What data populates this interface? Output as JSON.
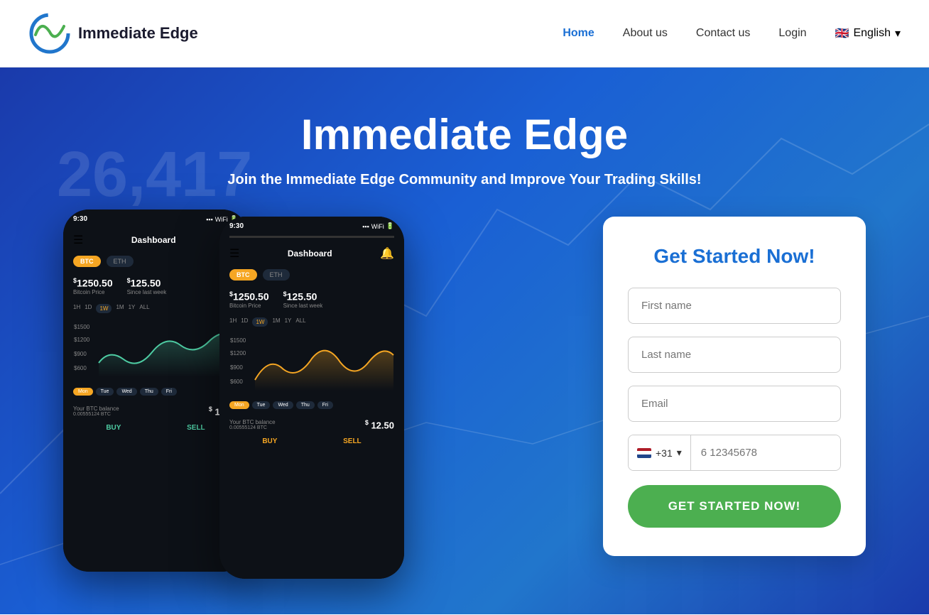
{
  "header": {
    "logo_text": "Immediate Edge",
    "nav": {
      "home": "Home",
      "about": "About us",
      "contact": "Contact us",
      "login": "Login",
      "lang": "English"
    }
  },
  "hero": {
    "bg_number": "26,417",
    "title": "Immediate Edge",
    "subtitle": "Join the Immediate Edge Community and Improve Your Trading Skills!",
    "phone1": {
      "time": "9:30",
      "title": "Dashboard",
      "btc": "BTC",
      "eth": "ETH",
      "price1_label": "Bitcoin Price",
      "price1_amount": "$1250.50",
      "price2_label": "Since last week",
      "price2_amount": "$125.50",
      "time_tabs": [
        "1H",
        "1D",
        "1W",
        "1M",
        "1Y",
        "ALL"
      ],
      "active_tab": "1W",
      "chart_label": "green",
      "days": [
        "Mon",
        "Tue",
        "Wed",
        "Thu",
        "Fri"
      ],
      "active_day": "Mon",
      "balance_label": "Your BTC balance",
      "balance_sub": "0.00555124 BTC",
      "balance_amount": "$12.50",
      "btn_buy": "BUY",
      "btn_sell": "SELL"
    },
    "phone2": {
      "time": "9:30",
      "title": "Dashboard",
      "btc": "BTC",
      "eth": "ETH",
      "price1_label": "Bitcoin Price",
      "price1_amount": "$1250.50",
      "price2_label": "Since last week",
      "price2_amount": "$125.50",
      "time_tabs": [
        "1H",
        "1D",
        "1W",
        "1M",
        "1Y",
        "ALL"
      ],
      "active_tab": "1W",
      "chart_label": "yellow",
      "days": [
        "Mon",
        "Tue",
        "Wed",
        "Thu",
        "Fri"
      ],
      "active_day": "Mon",
      "balance_label": "Your BTC balance",
      "balance_sub": "0.00555124 BTC",
      "balance_amount": "$12.50",
      "btn_buy": "BUY",
      "btn_sell": "SELL"
    }
  },
  "form": {
    "title": "Get Started Now!",
    "first_name_placeholder": "First name",
    "last_name_placeholder": "Last name",
    "email_placeholder": "Email",
    "phone_code": "+31",
    "phone_placeholder": "6 12345678",
    "submit_label": "GET STARTED NOW!"
  }
}
